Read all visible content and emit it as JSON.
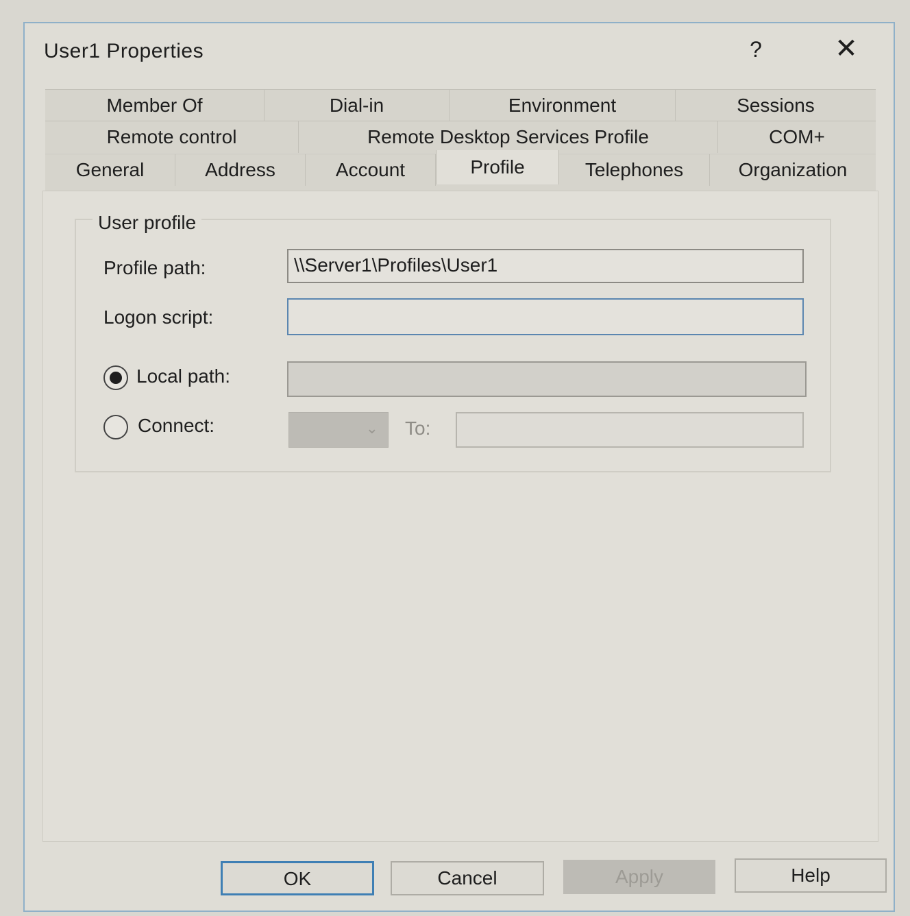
{
  "window": {
    "title": "User1 Properties",
    "help_label": "?",
    "close_label": "✕"
  },
  "tabs": {
    "row1": [
      "Member Of",
      "Dial-in",
      "Environment",
      "Sessions"
    ],
    "row2": [
      "Remote control",
      "Remote Desktop Services Profile",
      "COM+"
    ],
    "row3": [
      "General",
      "Address",
      "Account",
      "Profile",
      "Telephones",
      "Organization"
    ],
    "active": "Profile"
  },
  "user_profile": {
    "group_label": "User profile",
    "profile_path_label": "Profile path:",
    "profile_path_value": "\\\\Server1\\Profiles\\User1",
    "logon_script_label": "Logon script:",
    "logon_script_value": ""
  },
  "home_folder": {
    "local_path_label": "Local path:",
    "local_path_value": "",
    "local_path_selected": true,
    "connect_label": "Connect:",
    "to_label": "To:",
    "to_value": ""
  },
  "buttons": {
    "ok": "OK",
    "cancel": "Cancel",
    "apply": "Apply",
    "help": "Help"
  }
}
